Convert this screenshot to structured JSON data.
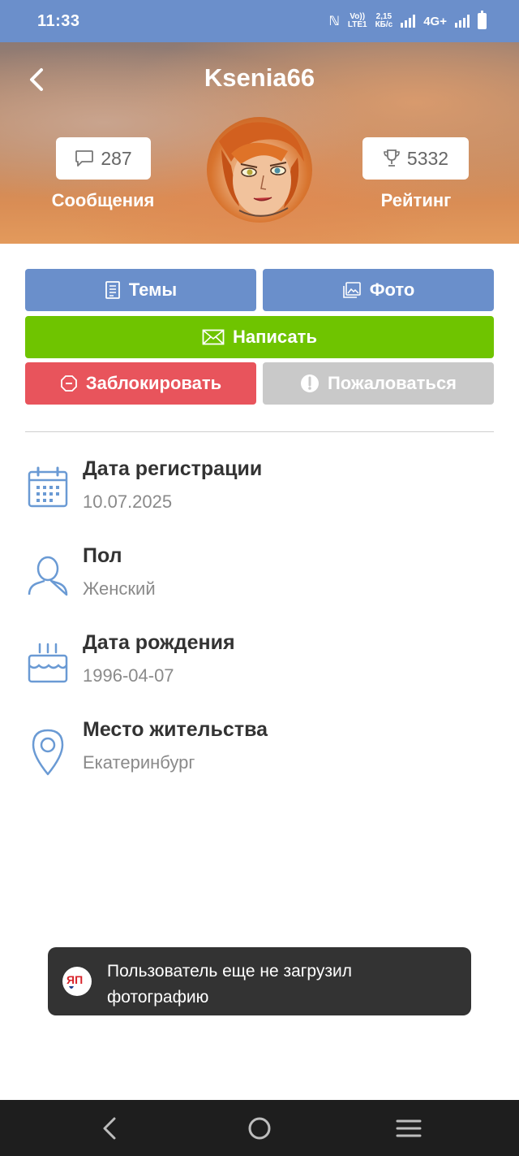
{
  "status_bar": {
    "time": "11:33",
    "volte_top": "Vo))",
    "volte_bottom": "LTE1",
    "speed_top": "2,15",
    "speed_bottom": "КБ/с",
    "network": "4G+"
  },
  "header": {
    "username": "Ksenia66",
    "messages_count": "287",
    "messages_label": "Сообщения",
    "rating_value": "5332",
    "rating_label": "Рейтинг"
  },
  "actions": {
    "topics": "Темы",
    "photo": "Фото",
    "write": "Написать",
    "block": "Заблокировать",
    "report": "Пожаловаться"
  },
  "info": [
    {
      "label": "Дата регистрации",
      "value": "10.07.2025",
      "icon": "calendar-icon"
    },
    {
      "label": "Пол",
      "value": "Женский",
      "icon": "user-icon"
    },
    {
      "label": "Дата рождения",
      "value": "1996-04-07",
      "icon": "birthday-cake-icon"
    },
    {
      "label": "Место жительства",
      "value": "Екатеринбург",
      "icon": "location-pin-icon"
    }
  ],
  "toast": {
    "message": "Пользователь еще не загрузил фотографию",
    "logo_text": "ЯП"
  },
  "colors": {
    "status_bar": "#6b8fcb",
    "primary_button": "#6a8fcb",
    "write_button": "#6fc400",
    "block_button": "#e8545c",
    "report_button": "#c9c9c9",
    "icon_blue": "#6a9ad4"
  }
}
